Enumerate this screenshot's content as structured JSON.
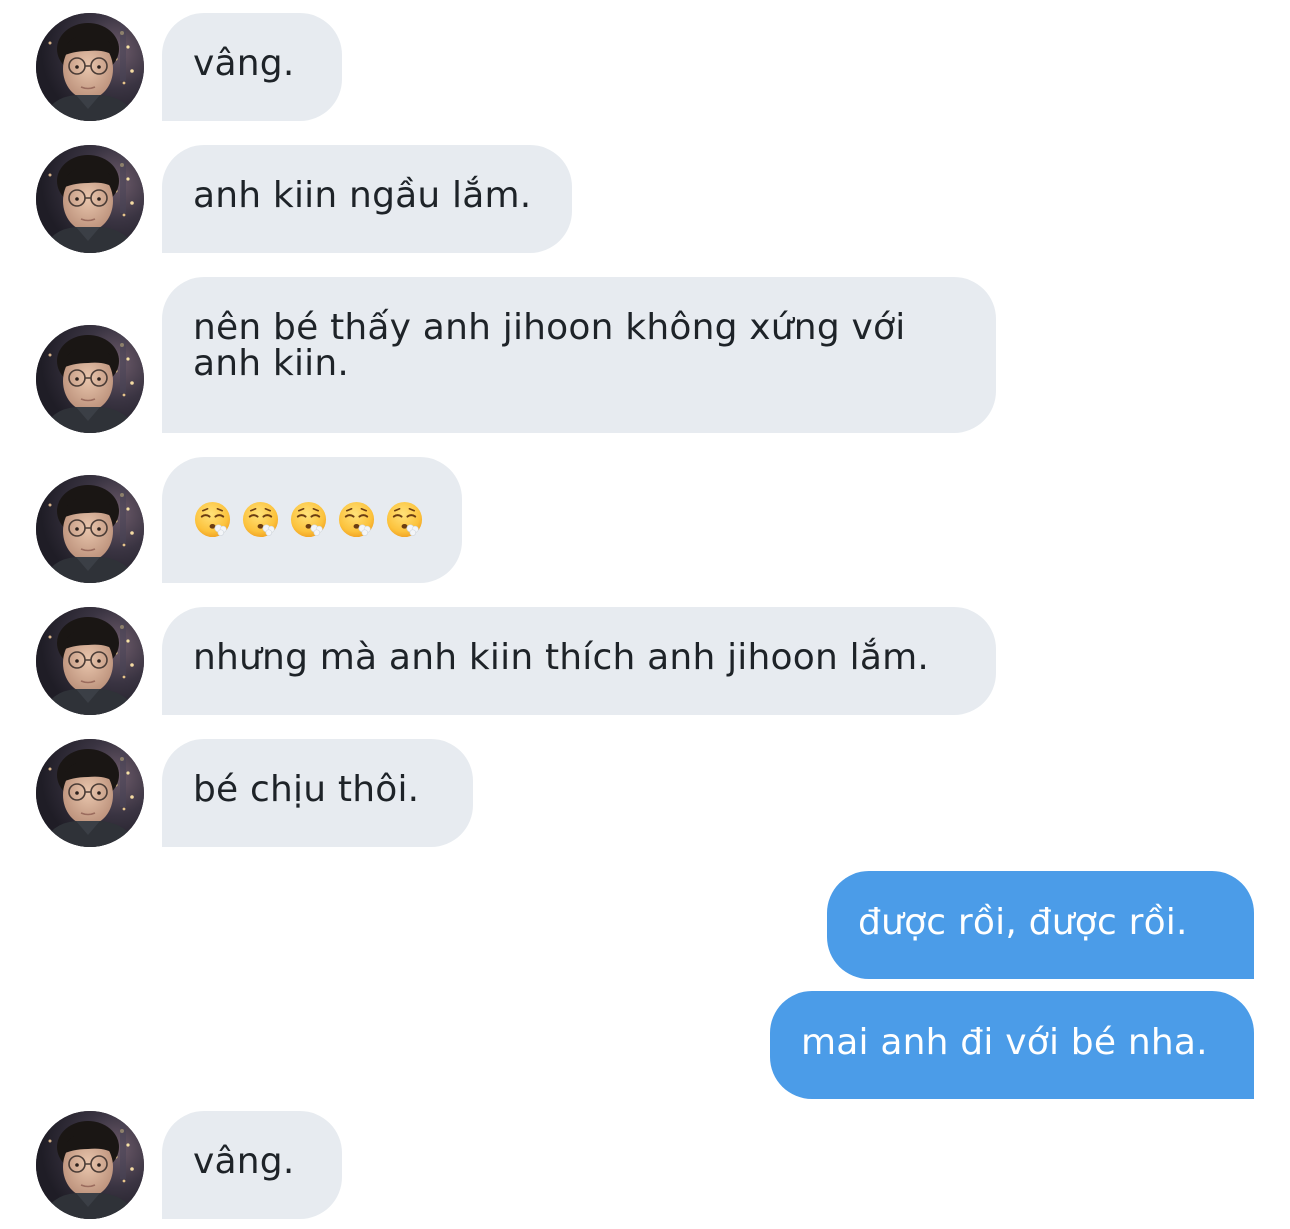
{
  "colors": {
    "incoming_bubble": "#e7ebf0",
    "outgoing_bubble": "#4b9ce8",
    "incoming_text": "#1e2328",
    "outgoing_text": "#ffffff",
    "background": "#ffffff"
  },
  "messages": [
    {
      "side": "incoming",
      "text": "vâng."
    },
    {
      "side": "incoming",
      "text": "anh kiin ngầu lắm."
    },
    {
      "side": "incoming",
      "text": "nên bé thấy anh jihoon không xứng với\nanh kiin."
    },
    {
      "side": "incoming",
      "emoji": [
        "face-exhaling",
        "face-exhaling",
        "face-exhaling",
        "face-exhaling",
        "face-exhaling"
      ]
    },
    {
      "side": "incoming",
      "text": "nhưng mà anh kiin thích anh jihoon lắm."
    },
    {
      "side": "incoming",
      "text": "bé chịu thôi."
    },
    {
      "side": "outgoing",
      "text": "được rồi, được rồi."
    },
    {
      "side": "outgoing",
      "text": "mai anh đi với bé nha."
    },
    {
      "side": "incoming",
      "text": "vâng."
    }
  ],
  "avatar_icon": "user-avatar-photo"
}
